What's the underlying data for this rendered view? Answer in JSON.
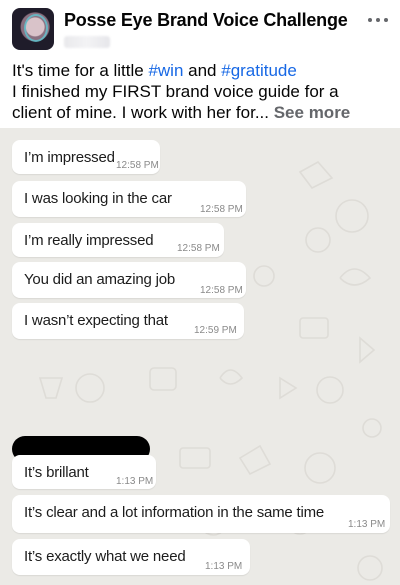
{
  "post": {
    "group_name": "Posse Eye Brand Voice Challenge",
    "avatar_icon": "group-avatar",
    "more_icon": "more-horizontal-icon",
    "text": {
      "line1_before": "It's time for a little ",
      "hashtag1": "#win",
      "line1_mid": " and ",
      "hashtag2": "#gratitude",
      "line2": "I finished my FIRST brand voice guide for a",
      "line3": "client of mine. I work with her for... ",
      "see_more": "See more"
    },
    "hashtag_color": "#1768e5"
  },
  "chat": {
    "background_color": "#ebeae6",
    "messages": [
      {
        "text": "I’m impressed",
        "time": "12:58 PM"
      },
      {
        "text": "I was looking in the car",
        "time": "12:58 PM"
      },
      {
        "text": "I’m really impressed",
        "time": "12:58 PM"
      },
      {
        "text": "You did an amazing job",
        "time": "12:58 PM"
      },
      {
        "text": "I wasn’t expecting that",
        "time": "12:59 PM"
      },
      {
        "text": "It’s brillant",
        "time": "1:13 PM"
      },
      {
        "text": "It’s clear and a lot information in the same time",
        "time": "1:13 PM"
      },
      {
        "text": "It’s exactly what we need",
        "time": "1:13 PM"
      }
    ]
  }
}
